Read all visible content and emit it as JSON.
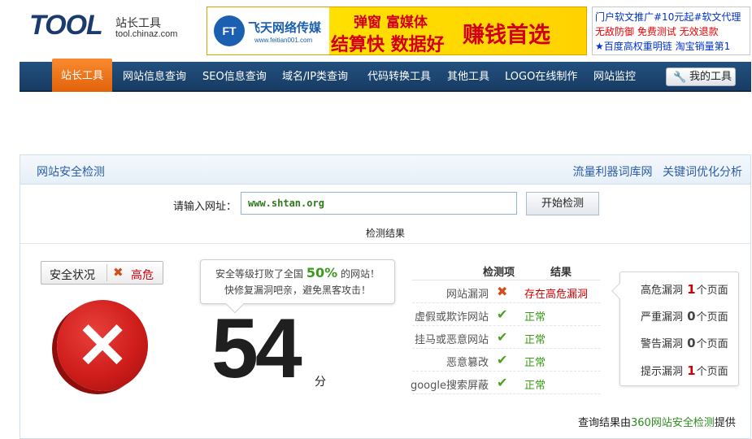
{
  "header": {
    "logo_mark": "TOOL",
    "logo_cn": "站长工具",
    "logo_domain": "tool.chinaz.com",
    "banner": {
      "badge": "FT",
      "brand": "飞天网络传媒",
      "url": "www.feitian001.com",
      "slogan1": "弹窗 富媒体",
      "slogan2": "结算快 数据好",
      "big": "赚钱首选"
    },
    "ad_lines": [
      "门户软文推广#10元起#软文代理",
      "无敌防御 免费测试 无效退款",
      "★百度高权重明链 淘宝销量第1"
    ]
  },
  "nav": {
    "items": [
      "站长工具",
      "网站信息查询",
      "SEO信息查询",
      "域名/IP类查询",
      "代码转换工具",
      "其他工具",
      "LOGO在线制作",
      "网站监控"
    ],
    "my_tools": "我的工具"
  },
  "panel": {
    "title": "网站安全检测",
    "links": [
      "流量利器词库网",
      "关键词优化分析"
    ],
    "search_label": "请输入网址：",
    "search_value": "www.shtan.org",
    "search_button": "开始检测",
    "result_title": "检测结果"
  },
  "status": {
    "label": "安全状况",
    "level": "高危"
  },
  "bubble": {
    "pre": "安全等级打败了全国",
    "percent": "50%",
    "post": "的网站！",
    "line2": "快修复漏洞吧亲，避免黑客攻击！"
  },
  "score": {
    "value": "54",
    "unit": "分"
  },
  "checks": {
    "header_item": "检测项",
    "header_result": "结果",
    "rows": [
      {
        "name": "网站漏洞",
        "result": "存在高危漏洞",
        "ok": false
      },
      {
        "name": "虚假或欺诈网站",
        "result": "正常",
        "ok": true
      },
      {
        "name": "挂马或恶意网站",
        "result": "正常",
        "ok": true
      },
      {
        "name": "恶意篡改",
        "result": "正常",
        "ok": true
      },
      {
        "name": "google搜索屏蔽",
        "result": "正常",
        "ok": true
      }
    ]
  },
  "summary": {
    "rows": [
      {
        "label": "高危漏洞",
        "count": "1",
        "suffix": "个页面",
        "color": "#d10000"
      },
      {
        "label": "严重漏洞",
        "count": "0",
        "suffix": "个页面",
        "color": "#444444"
      },
      {
        "label": "警告漏洞",
        "count": "0",
        "suffix": "个页面",
        "color": "#444444"
      },
      {
        "label": "提示漏洞",
        "count": "1",
        "suffix": "个页面",
        "color": "#d10000"
      }
    ]
  },
  "credit": {
    "pre": "查询结果由",
    "link": "360网站安全检测",
    "post": "提供"
  }
}
